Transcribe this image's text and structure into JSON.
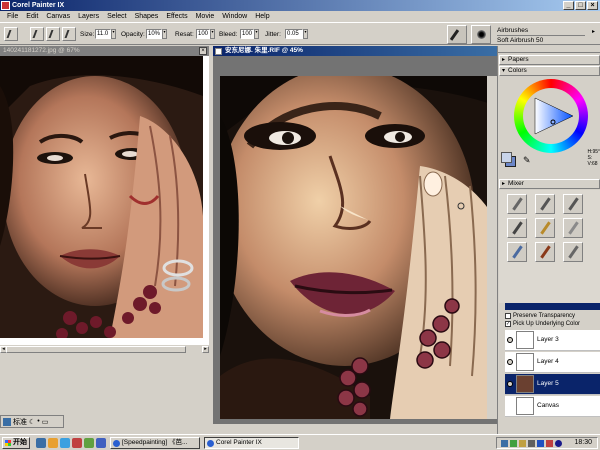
{
  "app": {
    "title": "Corel Painter IX",
    "window_buttons": [
      "_",
      "□",
      "×"
    ]
  },
  "menu": [
    "File",
    "Edit",
    "Canvas",
    "Layers",
    "Select",
    "Shapes",
    "Effects",
    "Movie",
    "Window",
    "Help"
  ],
  "toolbar": {
    "size_label": "Size:",
    "size_value": "11.0",
    "opacity_label": "Opacity:",
    "opacity_value": "10%",
    "resat_label": "Resat:",
    "resat_value": "100",
    "bleed_label": "Bleed:",
    "bleed_value": "100",
    "jitter_label": "Jitter:",
    "jitter_value": "0.05",
    "brush_category": "Airbrushes",
    "brush_variant": "Soft Airbrush 50"
  },
  "documents": {
    "reference": {
      "title": "140241181272.jpg @ 67%"
    },
    "painting": {
      "title": "安东尼娜. 朱里.RIF @ 45%"
    }
  },
  "panel": {
    "papers": "Papers",
    "colors": "Colors",
    "mixer": "Mixer",
    "hsv": [
      "H:95°",
      "S:",
      "V:68"
    ],
    "brush_variant_colors": [
      "#666",
      "#555",
      "#555",
      "#444",
      "#b88a2a",
      "#8a8a8a",
      "#4a6aa0",
      "#8a3a1a",
      "#666"
    ],
    "layers": {
      "preserve_transparency": "Preserve Transparency",
      "pick_up_underlying": "Pick Up Underlying Color",
      "items": [
        {
          "name": "Layer 3",
          "selected": false
        },
        {
          "name": "Layer 4",
          "selected": false
        },
        {
          "name": "Layer 5",
          "selected": true
        },
        {
          "name": "Canvas",
          "selected": false
        }
      ]
    }
  },
  "ime": {
    "label": "标准"
  },
  "taskbar": {
    "start": "开始",
    "tasks": [
      {
        "label": "[Speedpainting] 《芭...",
        "active": false
      },
      {
        "label": "Corel Painter IX",
        "active": true
      }
    ],
    "clock": "18:30"
  }
}
